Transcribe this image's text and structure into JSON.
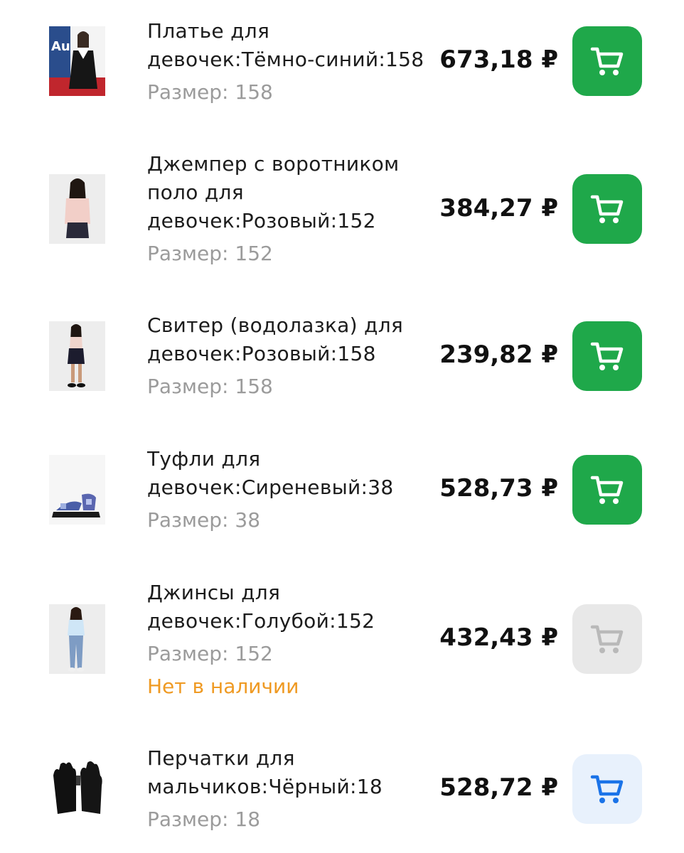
{
  "colors": {
    "cart_active": "#1fa84a",
    "cart_disabled": "#e8e8e8",
    "cart_alt": "#e8f1fc",
    "cart_alt_icon": "#1a73e8",
    "out_of_stock": "#ef9a23",
    "size_text": "#9b9b9b"
  },
  "items": [
    {
      "title": "Платье для девочек:Тёмно-синий:158",
      "size": "Размер: 158",
      "price": "673,18 ₽",
      "stock": "",
      "cart_state": "active",
      "cart_icon": "cart-icon"
    },
    {
      "title": "Джемпер с воротником поло для девочек:Розовый:152",
      "size": "Размер: 152",
      "price": "384,27 ₽",
      "stock": "",
      "cart_state": "active",
      "cart_icon": "cart-icon"
    },
    {
      "title": "Свитер (водолазка) для девочек:Розовый:158",
      "size": "Размер: 158",
      "price": "239,82 ₽",
      "stock": "",
      "cart_state": "active",
      "cart_icon": "cart-icon"
    },
    {
      "title": "Туфли для девочек:Сиреневый:38",
      "size": "Размер: 38",
      "price": "528,73 ₽",
      "stock": "",
      "cart_state": "active",
      "cart_icon": "cart-icon"
    },
    {
      "title": "Джинсы для девочек:Голубой:152",
      "size": "Размер: 152",
      "price": "432,43 ₽",
      "stock": "Нет в наличии",
      "cart_state": "disabled",
      "cart_icon": "cart-icon"
    },
    {
      "title": "Перчатки для мальчиков:Чёрный:18",
      "size": "Размер: 18",
      "price": "528,72 ₽",
      "stock": "",
      "cart_state": "alt",
      "cart_icon": "cart-icon"
    }
  ]
}
